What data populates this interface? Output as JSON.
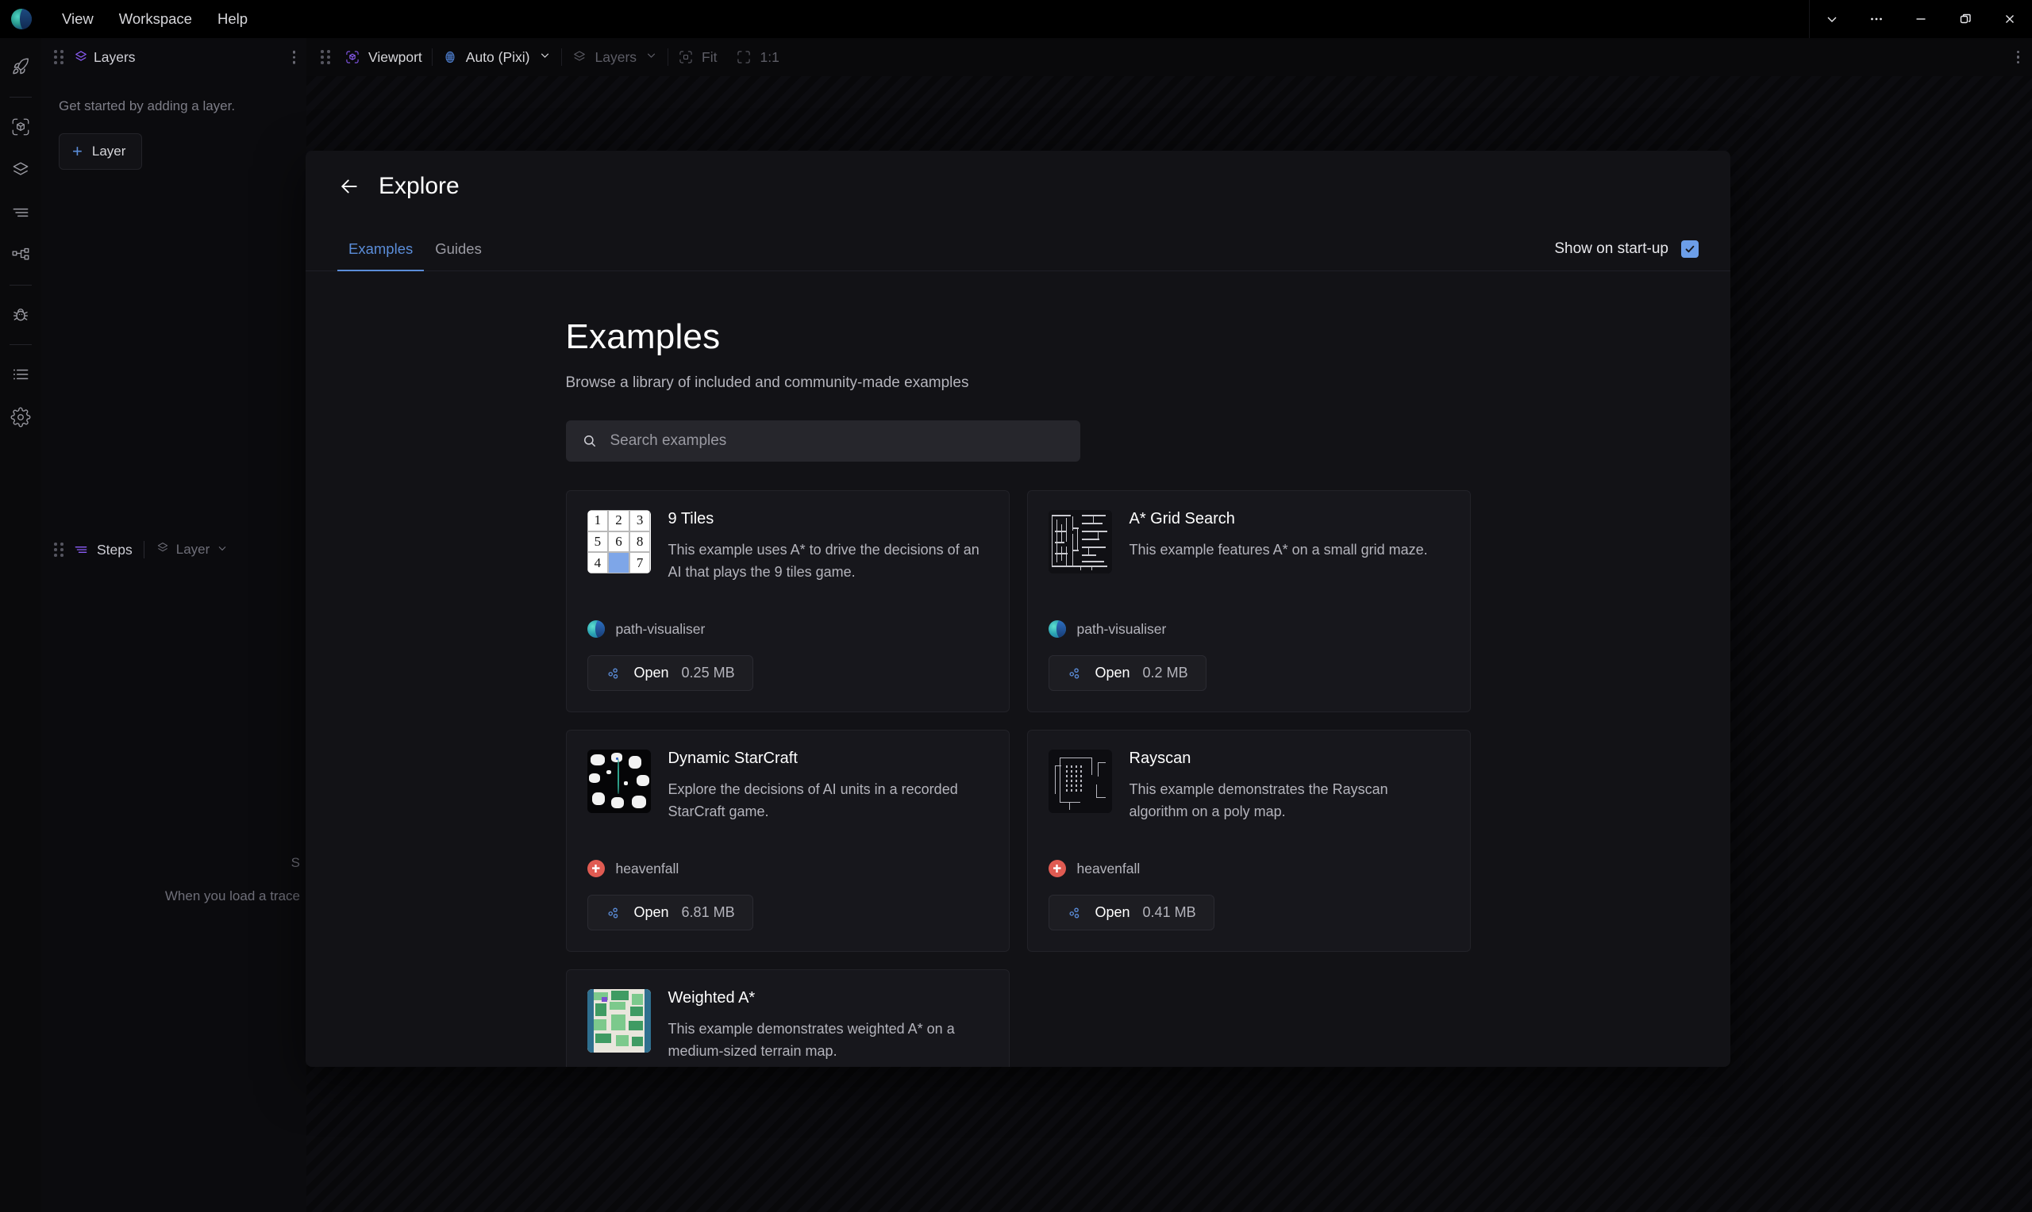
{
  "titlebar": {
    "menus": [
      {
        "label": "View"
      },
      {
        "label": "Workspace"
      },
      {
        "label": "Help"
      }
    ],
    "window_controls": [
      {
        "name": "chevron-down-icon",
        "label": "⌄"
      },
      {
        "name": "more-options-icon",
        "label": "⋯"
      },
      {
        "name": "minimize-icon",
        "label": "—"
      },
      {
        "name": "maximize-icon",
        "label": "❐"
      },
      {
        "name": "close-icon",
        "label": "✕"
      }
    ]
  },
  "rail": {
    "items": [
      {
        "name": "rocket-icon",
        "label": "Explore"
      },
      {
        "name": "scene-cube-icon",
        "label": "Scene"
      },
      {
        "name": "layers-icon",
        "label": "Layers"
      },
      {
        "name": "steps-icon",
        "label": "Steps"
      },
      {
        "name": "graph-icon",
        "label": "Structure"
      },
      {
        "name": "bug-icon",
        "label": "Debug"
      },
      {
        "name": "list-icon",
        "label": "Log"
      },
      {
        "name": "gear-icon",
        "label": "Settings"
      }
    ]
  },
  "layers_panel": {
    "title": "Layers",
    "empty_text": "Get started by adding a layer.",
    "add_button": "Layer",
    "add_button_plus": "+"
  },
  "steps_bar": {
    "title": "Steps",
    "dropdown_label": "Layer"
  },
  "viewport_toolbar": {
    "viewport_label": "Viewport",
    "renderer_label": "Auto (Pixi)",
    "layers_label": "Layers",
    "fit_label": "Fit",
    "zoom_label": "1:1"
  },
  "canvas": {
    "hint_partial_title": "S",
    "hint_partial_text": "When you load a trace"
  },
  "dialog": {
    "title": "Explore",
    "back_icon": "arrow-left-icon",
    "tabs": [
      {
        "label": "Examples",
        "active": true
      },
      {
        "label": "Guides",
        "active": false
      }
    ],
    "startup_label": "Show on start-up",
    "startup_checked": true,
    "heading": "Examples",
    "subheading": "Browse a library of included and community-made examples",
    "search": {
      "placeholder": "Search examples",
      "value": ""
    },
    "open_label": "Open",
    "examples": [
      {
        "title": "9 Tiles",
        "description": "This example uses A* to drive the decisions of an AI that plays the 9 tiles game.",
        "author": "path-visualiser",
        "author_kind": "pv",
        "size": "0.25 MB",
        "thumb": "tiles",
        "tile_values": [
          "1",
          "2",
          "3",
          "5",
          "6",
          "8",
          "4",
          "",
          "7"
        ]
      },
      {
        "title": "A* Grid Search",
        "description": "This example features A* on a small grid maze.",
        "author": "path-visualiser",
        "author_kind": "pv",
        "size": "0.2 MB",
        "thumb": "maze"
      },
      {
        "title": "Dynamic StarCraft",
        "description": "Explore the decisions of AI units in a recorded StarCraft game.",
        "author": "heavenfall",
        "author_kind": "hf",
        "size": "6.81 MB",
        "thumb": "starcraft"
      },
      {
        "title": "Rayscan",
        "description": "This example demonstrates the Rayscan algorithm on a poly map.",
        "author": "heavenfall",
        "author_kind": "hf",
        "size": "0.41 MB",
        "thumb": "rayscan"
      },
      {
        "title": "Weighted A*",
        "description": "This example demonstrates weighted A* on a medium-sized terrain map.",
        "author": "",
        "author_kind": "",
        "size": "",
        "thumb": "terrain"
      }
    ]
  },
  "colors": {
    "accent_blue": "#5b8dd9",
    "accent_purple": "#8b5cf6",
    "checkbox_blue": "#6c9ee8",
    "background": "#0a0a0c",
    "dialog_bg": "#121216",
    "card_bg": "#17171c"
  }
}
